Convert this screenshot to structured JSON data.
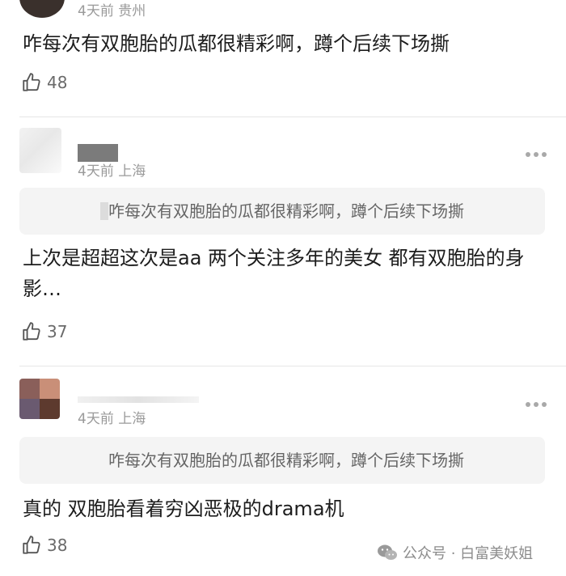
{
  "comments": [
    {
      "time": "4天前",
      "location": "贵州",
      "body": "咋每次有双胞胎的瓜都很精彩啊，蹲个后续下场撕",
      "likes": "48"
    },
    {
      "time": "4天前",
      "location": "上海",
      "quote": "咋每次有双胞胎的瓜都很精彩啊，蹲个后续下场撕",
      "body": "上次是超超这次是aa 两个关注多年的美女  都有双胞胎的身影…",
      "likes": "37"
    },
    {
      "time": "4天前",
      "location": "上海",
      "quote": "咋每次有双胞胎的瓜都很精彩啊，蹲个后续下场撕",
      "body": "真的 双胞胎看着穷凶恶极的drama机",
      "likes": "38"
    }
  ],
  "watermark": {
    "text": "公众号 · 白富美妖姐"
  },
  "colors": {
    "meta": "#9a9a9a",
    "quote_bg": "#f4f4f4",
    "divider": "#e6e6e6"
  },
  "icons": {
    "like": "thumbs-up-icon",
    "more": "more-dots-icon",
    "wechat": "wechat-icon"
  }
}
